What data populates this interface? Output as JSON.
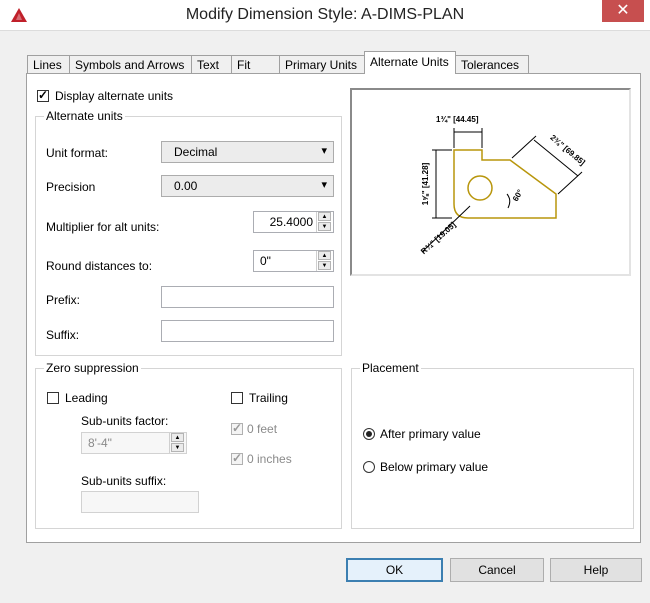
{
  "window": {
    "title": "Modify Dimension Style: A-DIMS-PLAN",
    "close_glyph": "✕"
  },
  "tabs": [
    "Lines",
    "Symbols and Arrows",
    "Text",
    "Fit",
    "Primary Units",
    "Alternate Units",
    "Tolerances"
  ],
  "active_tab": "Alternate Units",
  "display_alternate_units": {
    "label": "Display alternate units",
    "checked": true
  },
  "alternate_units": {
    "title": "Alternate units",
    "unit_format": {
      "label": "Unit format:",
      "value": "Decimal"
    },
    "precision": {
      "label": "Precision",
      "value": "0.00"
    },
    "multiplier": {
      "label": "Multiplier for alt units:",
      "value": "25.4000"
    },
    "round": {
      "label": "Round distances to:",
      "value": "0\""
    },
    "prefix": {
      "label": "Prefix:",
      "value": ""
    },
    "suffix": {
      "label": "Suffix:",
      "value": ""
    }
  },
  "zero_suppression": {
    "title": "Zero suppression",
    "leading": {
      "label": "Leading",
      "checked": false
    },
    "trailing": {
      "label": "Trailing",
      "checked": false
    },
    "sub_units_factor": {
      "label": "Sub-units factor:",
      "value": "8'-4\""
    },
    "zero_feet": {
      "label": "0 feet",
      "checked": true
    },
    "zero_inches": {
      "label": "0 inches",
      "checked": true
    },
    "sub_units_suffix": {
      "label": "Sub-units suffix:",
      "value": ""
    }
  },
  "placement": {
    "title": "Placement",
    "options": [
      "After primary value",
      "Below primary value"
    ],
    "selected": "After primary value"
  },
  "preview": {
    "label_top": "1¾\" [44.45]",
    "label_left": "1⅝\" [41.28]",
    "label_right": "2¾\" [69.85]",
    "label_angle": "60°",
    "label_radius": "R¾\" [19.05]",
    "drawing_color": "#b8960c"
  },
  "buttons": {
    "ok": "OK",
    "cancel": "Cancel",
    "help": "Help"
  },
  "colors": {
    "accent": "#3c7fb1",
    "close": "#c74f4f",
    "logo": "#c0202a"
  }
}
